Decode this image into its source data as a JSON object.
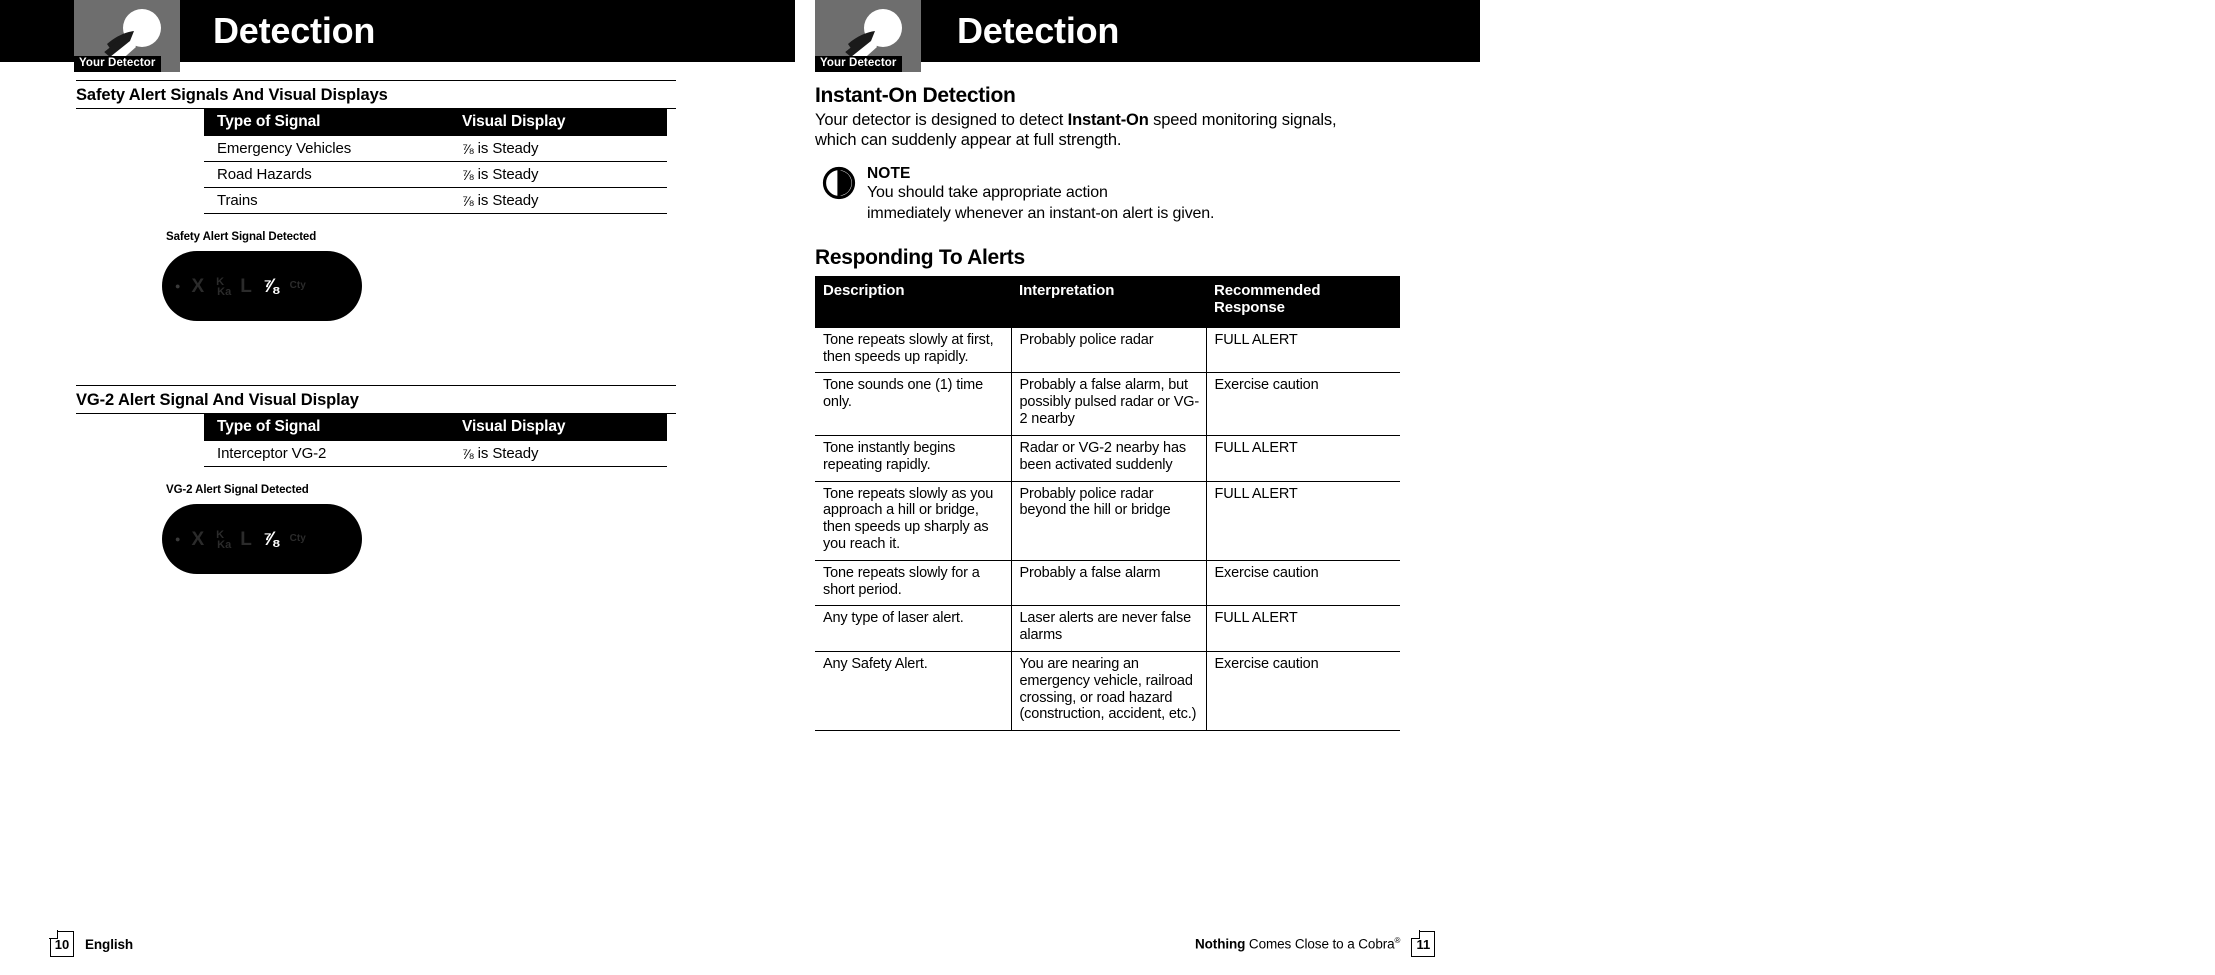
{
  "headers": [
    {
      "logo_tag": "Your Detector",
      "title": "Detection",
      "logo_icon": "detector-logo-icon"
    },
    {
      "logo_tag": "Your Detector",
      "title": "Detection",
      "logo_icon": "detector-logo-icon"
    }
  ],
  "left_column": {
    "section1": {
      "heading": "Safety Alert Signals And Visual Displays",
      "table": {
        "columns": [
          "Type of Signal",
          "Visual Display"
        ],
        "rows": [
          [
            "Emergency Vehicles",
            "V/S is Steady"
          ],
          [
            "Road Hazards",
            "V/S is Steady"
          ],
          [
            "Trains",
            "V/S is Steady"
          ]
        ]
      },
      "lcd_caption": "Safety Alert Signal Detected",
      "lcd_segments": [
        "•",
        "X",
        "K/Ka",
        "L",
        "V/S",
        "Cty"
      ],
      "lcd_active_segment": "V/S"
    },
    "section2": {
      "heading": "VG-2 Alert Signal And Visual Display",
      "table": {
        "columns": [
          "Type of Signal",
          "Visual Display"
        ],
        "rows": [
          [
            "Interceptor VG-2",
            "V/S is Steady"
          ]
        ]
      },
      "lcd_caption": "VG-2 Alert Signal Detected",
      "lcd_segments": [
        "•",
        "X",
        "K/Ka",
        "L",
        "V/S",
        "Cty"
      ],
      "lcd_active_segment": "V/S"
    }
  },
  "right_column": {
    "instant_on": {
      "heading": "Instant-On Detection",
      "paragraph_part1": "Your detector is designed to detect ",
      "paragraph_bold": "Instant-On",
      "paragraph_part2": " speed monitoring signals, which can suddenly appear at full strength."
    },
    "note": {
      "icon": "note-info-icon",
      "title": "NOTE",
      "line1": "You should take appropriate action",
      "line2": "immediately whenever an instant-on alert is given."
    },
    "responding": {
      "heading": "Responding To Alerts",
      "columns": [
        "Description",
        "Interpretation",
        "Recommended Response"
      ],
      "rows": [
        {
          "description": "Tone repeats slowly at first, then speeds up rapidly.",
          "interpretation": "Probably police radar",
          "response": "FULL ALERT"
        },
        {
          "description": "Tone sounds one (1) time only.",
          "interpretation": "Probably a false alarm, but possibly pulsed radar or VG-2 nearby",
          "response": "Exercise caution"
        },
        {
          "description": "Tone instantly begins repeating rapidly.",
          "interpretation": "Radar or VG-2 nearby has been activated suddenly",
          "response": "FULL ALERT"
        },
        {
          "description": "Tone repeats slowly as you approach a hill or bridge, then speeds up sharply as you reach it.",
          "interpretation": "Probably police radar beyond the hill or bridge",
          "response": "FULL ALERT"
        },
        {
          "description": "Tone repeats slowly for a short period.",
          "interpretation": "Probably a false alarm",
          "response": "Exercise caution"
        },
        {
          "description": "Any type of laser alert.",
          "interpretation": "Laser alerts are never false alarms",
          "response": "FULL ALERT"
        },
        {
          "description": "Any Safety Alert.",
          "interpretation": "You are nearing an emergency vehicle, railroad crossing, or road hazard (construction, accident, etc.)",
          "response": "Exercise caution"
        }
      ]
    }
  },
  "footer": {
    "left_page_number": "10",
    "language": "English",
    "tagline_strong": "Nothing",
    "tagline_rest": " Comes Close to a Cobra",
    "tagline_sup": "®",
    "right_page_number": "11"
  },
  "colors": {
    "ink": "#000000",
    "paper": "#ffffff",
    "logo_gray": "#6e6e6e",
    "lcd_off": "#2b2b2b",
    "lcd_on": "#ffffff"
  }
}
